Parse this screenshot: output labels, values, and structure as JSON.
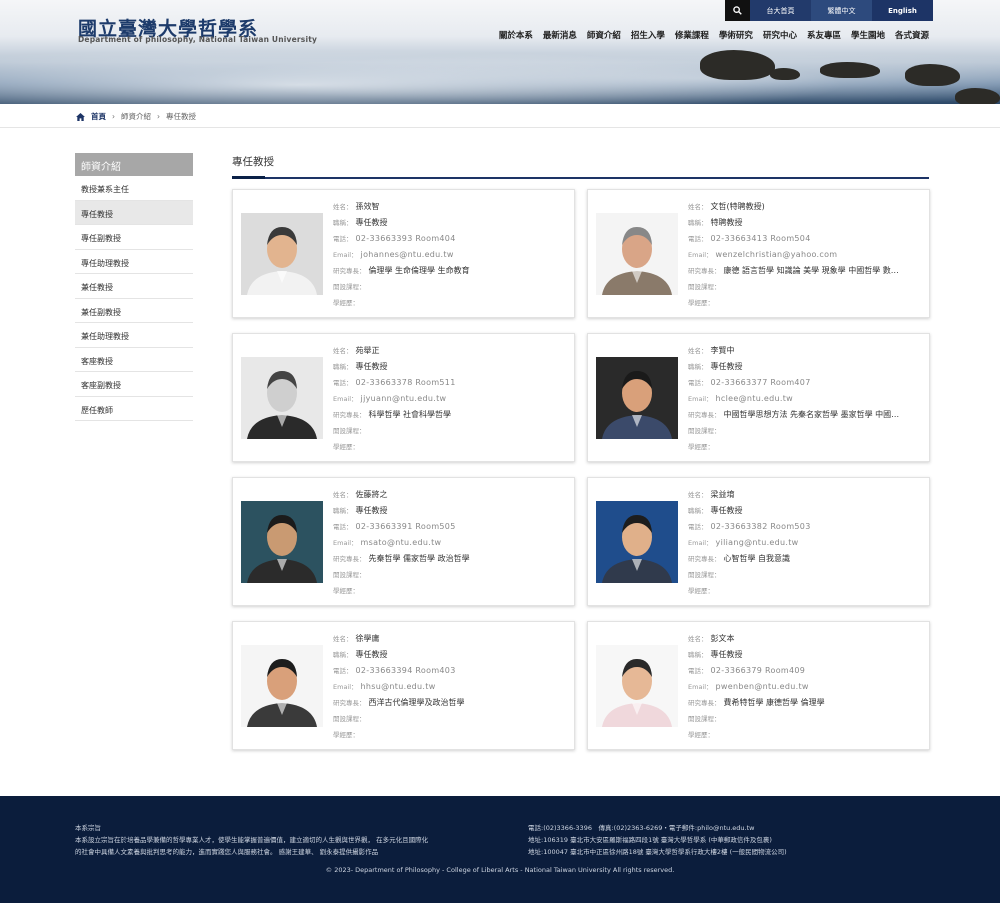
{
  "site": {
    "title": "國立臺灣大學哲學系",
    "subtitle": "Department of philosophy, National Taiwan University"
  },
  "topbar": [
    "台大首頁",
    "繁體中文",
    "English"
  ],
  "nav": [
    "關於本系",
    "最新消息",
    "師資介紹",
    "招生入學",
    "修業課程",
    "學術研究",
    "研究中心",
    "系友專區",
    "學生園地",
    "各式資源"
  ],
  "breadcrumb": [
    "首頁",
    "師資介紹",
    "專任教授"
  ],
  "sidebar": {
    "title": "師資介紹",
    "items": [
      "教授兼系主任",
      "專任教授",
      "專任副教授",
      "專任助理教授",
      "兼任教授",
      "兼任副教授",
      "兼任助理教授",
      "客座教授",
      "客座副教授",
      "歷任教師"
    ]
  },
  "content_title": "專任教授",
  "labels": {
    "name": "姓名：",
    "title": "職稱：",
    "phone": "電話：",
    "email": "Email：",
    "research": "研究專長：",
    "courses": "開設課程：",
    "education": "學經歷："
  },
  "faculty": [
    {
      "name": "孫效智",
      "title": "專任教授",
      "phone": "02-33663393 Room404",
      "email": "johannes@ntu.edu.tw",
      "research": "倫理學 生命倫理學 生命教育"
    },
    {
      "name": "文哲(特聘教授)",
      "title": "特聘教授",
      "phone": "02-33663413 Room504",
      "email": "wenzelchristian@yahoo.com",
      "research": "康德 語言哲學 知識論 美學 現象學 中國哲學 數…"
    },
    {
      "name": "苑舉正",
      "title": "專任教授",
      "phone": "02-33663378 Room511",
      "email": "jjyuann@ntu.edu.tw",
      "research": "科學哲學 社會科學哲學"
    },
    {
      "name": "李賢中",
      "title": "專任教授",
      "phone": "02-33663377 Room407",
      "email": "hclee@ntu.edu.tw",
      "research": "中國哲學思想方法 先秦名家哲學 墨家哲學 中國…"
    },
    {
      "name": "佐藤將之",
      "title": "專任教授",
      "phone": "02-33663391 Room505",
      "email": "msato@ntu.edu.tw",
      "research": "先秦哲學 儒家哲學 政治哲學"
    },
    {
      "name": "梁益堉",
      "title": "專任教授",
      "phone": "02-33663382 Room503",
      "email": "yiliang@ntu.edu.tw",
      "research": "心智哲學 自我意識"
    },
    {
      "name": "徐學庸",
      "title": "專任教授",
      "phone": "02-33663394 Room403",
      "email": "hhsu@ntu.edu.tw",
      "research": "西洋古代倫理學及政治哲學"
    },
    {
      "name": "彭文本",
      "title": "專任教授",
      "phone": "02-3366379 Room409",
      "email": "pwenben@ntu.edu.tw",
      "research": "費希特哲學 康德哲學 倫理學"
    }
  ],
  "footer": {
    "left_title": "本系宗旨",
    "left_line1": "本系設立宗旨在於培養品學兼備的哲學專業人才，使學生能掌握普遍價值，建立適切的人生觀與世界觀， 在多元化且國際化",
    "left_line2": "的社會中具備人文素養與批判思考的能力，進而實踐您人與服務社會。 感謝王建華、 劉永泰提供攝影作品",
    "right_line1": "電話:(02)3366-3396　傳真:(02)2363-6269・電子郵件:philo@ntu.edu.tw",
    "right_line2": "地址:106319 臺北市大安區羅斯福路四段1號 臺灣大學哲學系 (中華郵政信件及包裹)",
    "right_line3": "地址:100047 臺北市中正區徐州路18號 臺灣大學哲學系行政大樓2樓 (一般民間物流公司)",
    "copyright": "© 2023- Department of Philosophy - College of Liberal Arts - National Taiwan University All rights reserved."
  },
  "colors": {
    "brand": "#1d3466",
    "footer_bg": "#0b1d3c"
  }
}
